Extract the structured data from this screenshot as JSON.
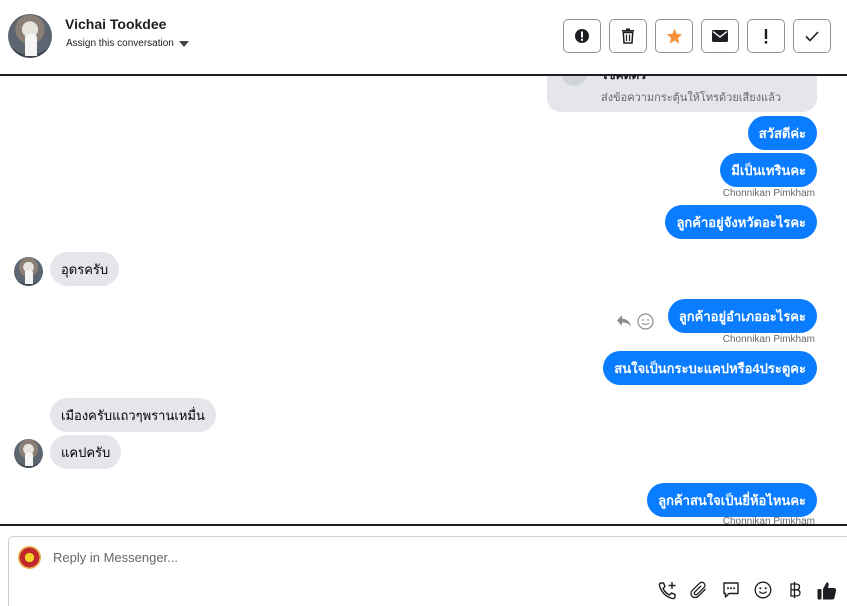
{
  "header": {
    "contact_name": "Vichai Tookdee",
    "assign_label": "Assign this conversation",
    "actions": [
      {
        "icon": "alert-circle-icon",
        "label": "mark as spam"
      },
      {
        "icon": "trash-icon",
        "label": "delete"
      },
      {
        "icon": "star-icon",
        "label": "star"
      },
      {
        "icon": "envelope-icon",
        "label": "mark as unread"
      },
      {
        "icon": "exclamation-icon",
        "label": "follow up"
      },
      {
        "icon": "check-icon",
        "label": "mark as done"
      }
    ],
    "colors": {
      "star": "#f7923b"
    }
  },
  "thread": {
    "card": {
      "title": "โชคดีตัว",
      "subtitle": "ส่งข้อความกระตุ้นให้โทรด้วยเสียงแล้ว"
    },
    "messages": [
      {
        "direction": "out",
        "text": "สวัสดีค่ะ"
      },
      {
        "direction": "out",
        "text": "มีเป็นเทรินคะ",
        "sender": "Chonnikan Pimkham"
      },
      {
        "direction": "out",
        "text": "ลูกค้าอยู่จังหวัดอะไรคะ"
      },
      {
        "direction": "in",
        "text": "อุดรครับ"
      },
      {
        "direction": "out",
        "text": "ลูกค้าอยู่อำเภออะไรคะ",
        "sender": "Chonnikan Pimkham"
      },
      {
        "direction": "out",
        "text": "สนใจเป็นกระบะแคปหรือ4ประตูคะ"
      },
      {
        "direction": "in",
        "text": "เมืองครับแถวๆพรานเหมื่น"
      },
      {
        "direction": "in",
        "text": "แคปครับ"
      },
      {
        "direction": "out",
        "text": "ลูกค้าสนใจเป็นยี่ห้อไหนคะ",
        "sender": "Chonnikan Pimkham"
      }
    ],
    "colors": {
      "outgoing": "#0a7cff",
      "incoming": "#e4e6eb"
    }
  },
  "composer": {
    "placeholder": "Reply in Messenger...",
    "tools": [
      "call-plus-icon",
      "paperclip-icon",
      "saved-reply-icon",
      "emoji-icon",
      "baht-icon",
      "thumbs-up-icon"
    ]
  }
}
